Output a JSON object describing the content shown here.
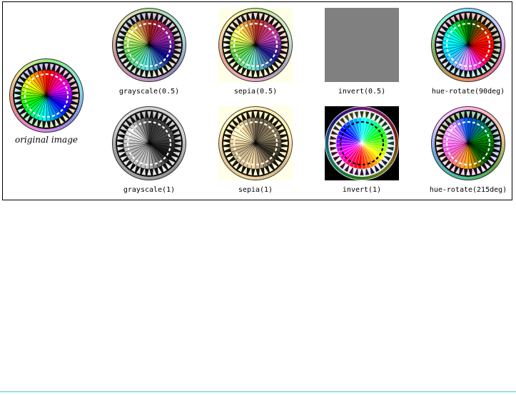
{
  "original": {
    "caption": "original image"
  },
  "filters": [
    {
      "id": "grayscale-half",
      "caption": "grayscale(0.5)",
      "css": "grayscale(0.5)"
    },
    {
      "id": "sepia-half",
      "caption": "sepia(0.5)",
      "css": "sepia(0.5)"
    },
    {
      "id": "invert-half",
      "caption": "invert(0.5)",
      "css": "invert(0.5)"
    },
    {
      "id": "hue-rotate-90",
      "caption": "hue-rotate(90deg)",
      "css": "hue-rotate(90deg)"
    },
    {
      "id": "grayscale-full",
      "caption": "grayscale(1)",
      "css": "grayscale(1)"
    },
    {
      "id": "sepia-full",
      "caption": "sepia(1)",
      "css": "sepia(1)"
    },
    {
      "id": "invert-full",
      "caption": "invert(1)",
      "css": "invert(1)"
    },
    {
      "id": "hue-rotate-215",
      "caption": "hue-rotate(215deg)",
      "css": "hue-rotate(215deg)"
    }
  ],
  "colors": {
    "frame_border": "#000000",
    "bottom_rule": "#4fc3d9",
    "wheel_bg_sepia_tint": "#fffbe6"
  }
}
